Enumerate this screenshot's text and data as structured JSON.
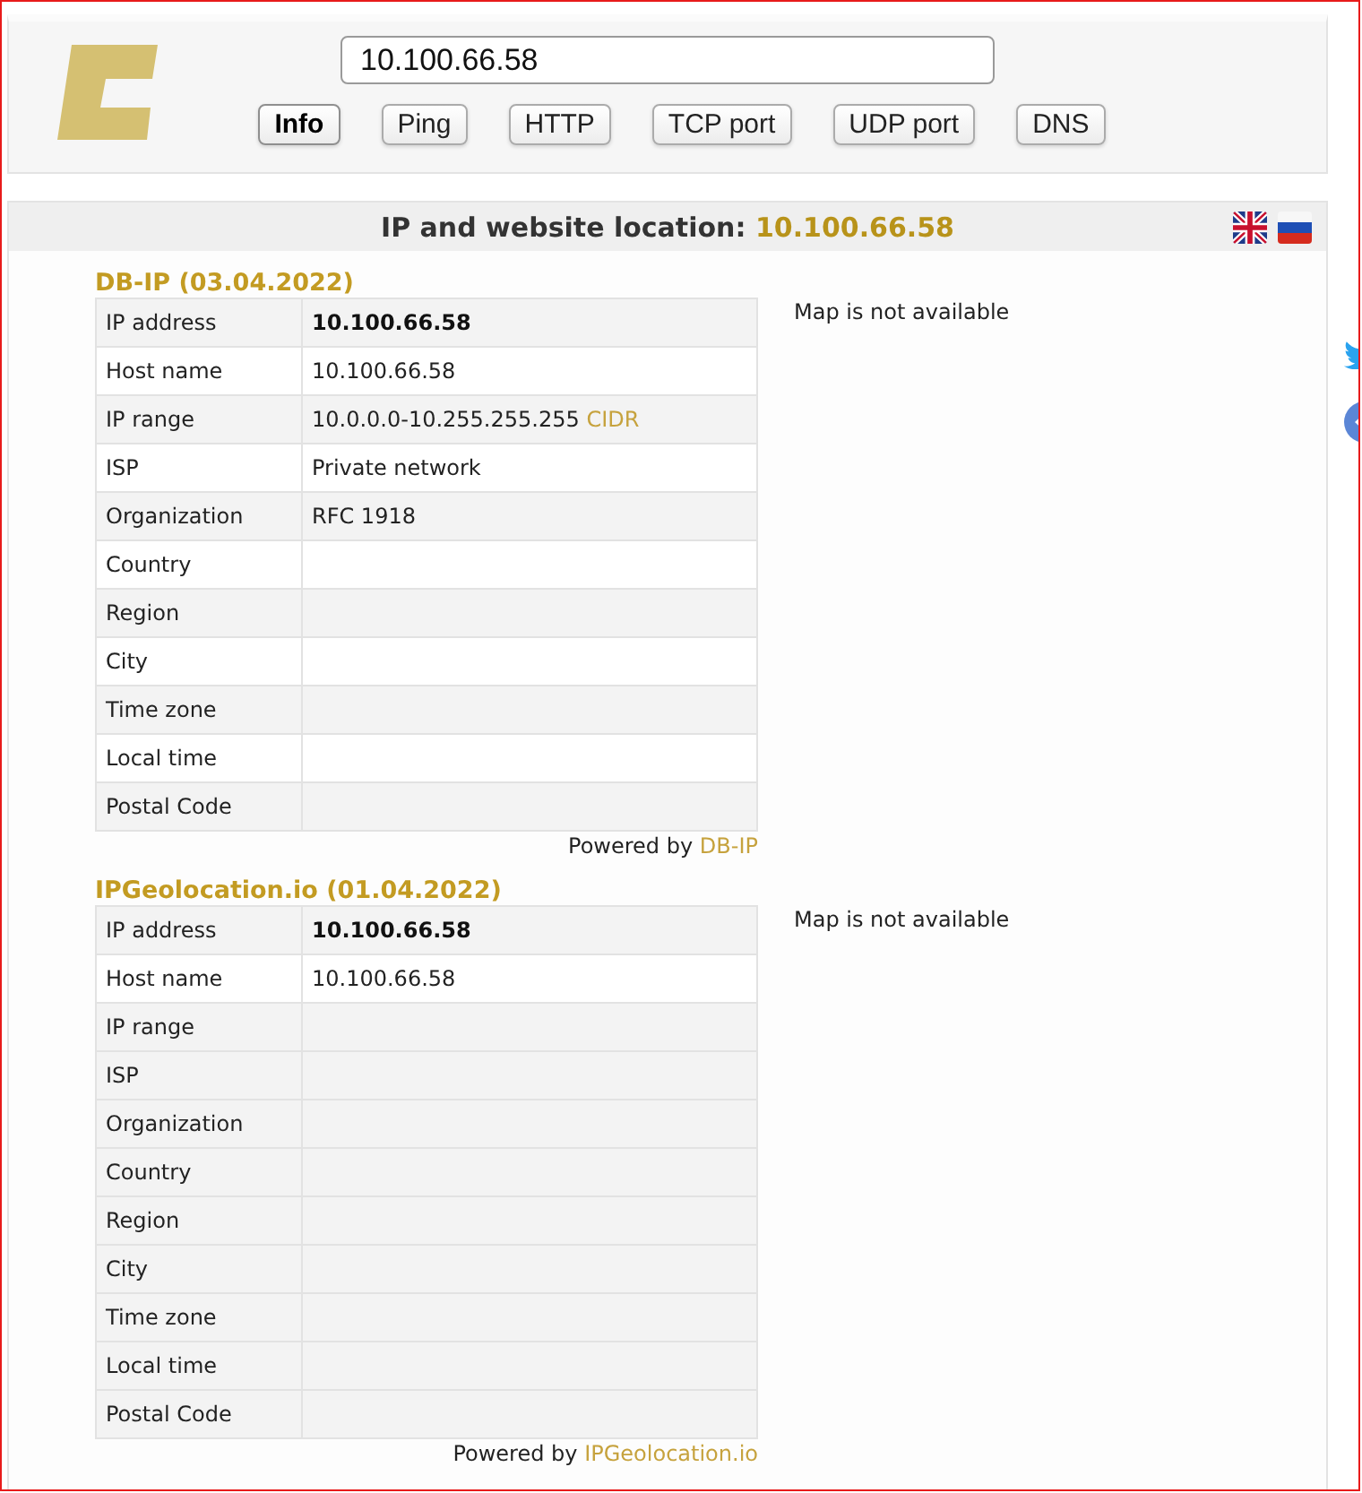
{
  "search": {
    "value": "10.100.66.58"
  },
  "tools": [
    {
      "label": "Info",
      "selected": true
    },
    {
      "label": "Ping",
      "selected": false
    },
    {
      "label": "HTTP",
      "selected": false
    },
    {
      "label": "TCP port",
      "selected": false
    },
    {
      "label": "UDP port",
      "selected": false
    },
    {
      "label": "DNS",
      "selected": false
    }
  ],
  "section": {
    "title": "IP and website location:",
    "address": "10.100.66.58"
  },
  "sources": [
    {
      "name": "DB-IP (03.04.2022)",
      "rows": [
        {
          "label": "IP address",
          "value": "10.100.66.58",
          "bold": true,
          "shaded": true
        },
        {
          "label": "Host name",
          "value": "10.100.66.58",
          "bold": false,
          "shaded": false
        },
        {
          "label": "IP range",
          "value": "10.0.0.0-10.255.255.255",
          "link": "CIDR",
          "bold": false,
          "shaded": true
        },
        {
          "label": "ISP",
          "value": "Private network",
          "bold": false,
          "shaded": false
        },
        {
          "label": "Organization",
          "value": "RFC 1918",
          "bold": false,
          "shaded": true
        },
        {
          "label": "Country",
          "shaded": false
        },
        {
          "label": "Region",
          "shaded": true
        },
        {
          "label": "City",
          "shaded": false
        },
        {
          "label": "Time zone",
          "shaded": true
        },
        {
          "label": "Local time",
          "shaded": false
        },
        {
          "label": "Postal Code",
          "shaded": true
        }
      ],
      "map_note": "Map is not available",
      "credit": {
        "prefix": "Powered by",
        "link": "DB-IP"
      }
    },
    {
      "name": "IPGeolocation.io (01.04.2022)",
      "rows": [
        {
          "label": "IP address",
          "value": "10.100.66.58",
          "bold": true,
          "shaded": true
        },
        {
          "label": "Host name",
          "value": "10.100.66.58",
          "bold": false,
          "shaded": false
        },
        {
          "label": "IP range",
          "shaded": true
        },
        {
          "label": "ISP",
          "shaded": true
        },
        {
          "label": "Organization",
          "shaded": true
        },
        {
          "label": "Country",
          "shaded": true
        },
        {
          "label": "Region",
          "shaded": true
        },
        {
          "label": "City",
          "shaded": true
        },
        {
          "label": "Time zone",
          "shaded": true
        },
        {
          "label": "Local time",
          "shaded": true
        },
        {
          "label": "Postal Code",
          "shaded": true
        }
      ],
      "map_note": "Map is not available",
      "credit": {
        "prefix": "Powered by",
        "link": "IPGeolocation.io"
      }
    }
  ]
}
